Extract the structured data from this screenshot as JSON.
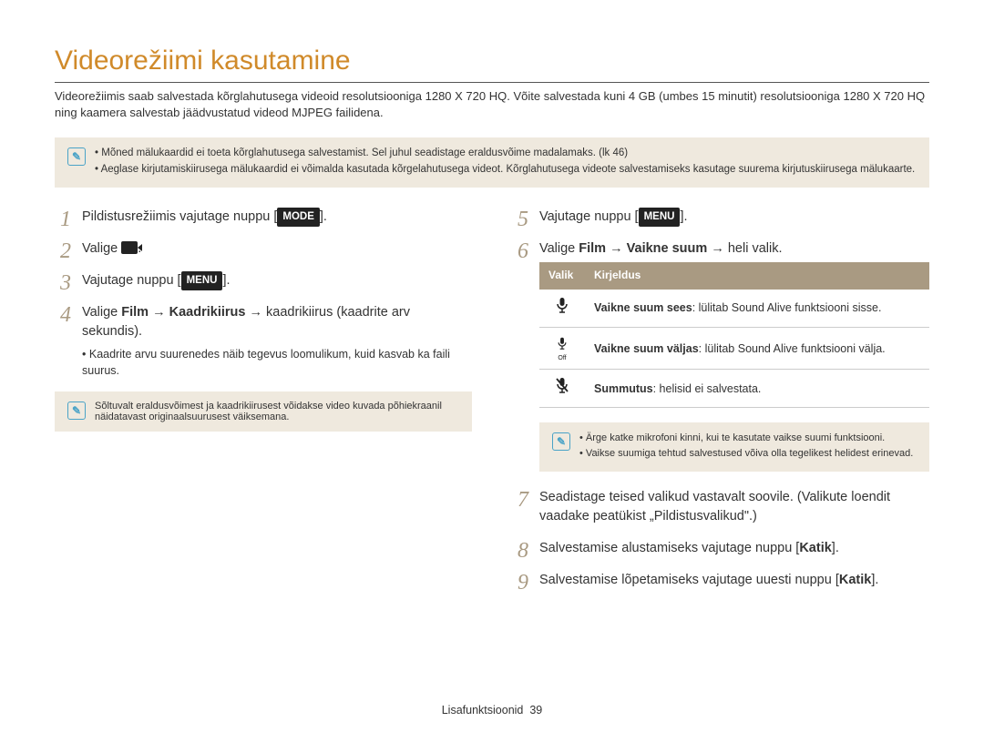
{
  "title": "Videorežiimi kasutamine",
  "intro": "Videorežiimis saab salvestada kõrglahutusega videoid resolutsiooniga 1280 X 720 HQ. Võite salvestada kuni 4 GB (umbes 15 minutit) resolutsiooniga 1280 X 720 HQ ning kaamera salvestab jäädvustatud videod MJPEG failidena.",
  "top_notes": [
    "Mõned mälukaardid ei toeta kõrglahutusega salvestamist. Sel juhul seadistage eraldusvõime madalamaks. (lk 46)",
    "Aeglase kirjutamiskiirusega mälukaardid ei võimalda kasutada kõrgelahutusega videot. Kõrglahutusega videote salvestamiseks kasutage suurema kirjutuskiirusega mälukaarte."
  ],
  "left_steps": {
    "s1_pre": "Pildistusrežiimis vajutage nuppu [",
    "s1_btn": "MODE",
    "s1_post": "].",
    "s2_pre": "Valige ",
    "s2_post": ".",
    "s3_pre": "Vajutage nuppu [",
    "s3_btn": "MENU",
    "s3_post": "].",
    "s4_pre": "Valige ",
    "s4_b1": "Film",
    "s4_arrow1": " → ",
    "s4_b2": "Kaadrikiirus",
    "s4_arrow2": " → ",
    "s4_rest": "kaadrikiirus (kaadrite arv sekundis).",
    "s4_bullet": "Kaadrite arvu suurenedes näib tegevus loomulikum, kuid kasvab ka faili suurus."
  },
  "left_note": "Sõltuvalt eraldusvõimest ja kaadrikiirusest võidakse video kuvada põhiekraanil näidatavast originaalsuurusest väiksemana.",
  "right_steps": {
    "s5_pre": "Vajutage nuppu [",
    "s5_btn": "MENU",
    "s5_post": "].",
    "s6_pre": "Valige ",
    "s6_b1": "Film",
    "s6_arrow1": " → ",
    "s6_b2": "Vaikne suum",
    "s6_arrow2": " → ",
    "s6_rest": "heli valik.",
    "s7": "Seadistage teised valikud vastavalt soovile. (Valikute loendit vaadake peatükist „Pildistusvalikud\".)",
    "s8_pre": "Salvestamise alustamiseks vajutage nuppu [",
    "s8_b": "Katik",
    "s8_post": "].",
    "s9_pre": "Salvestamise lõpetamiseks vajutage uuesti nuppu [",
    "s9_b": "Katik",
    "s9_post": "]."
  },
  "table": {
    "h1": "Valik",
    "h2": "Kirjeldus",
    "r1_b": "Vaikne suum sees",
    "r1_t": ": lülitab Sound Alive funktsiooni sisse.",
    "r2_b": "Vaikne suum väljas",
    "r2_t": ": lülitab Sound Alive funktsiooni välja.",
    "r3_b": "Summutus",
    "r3_t": ": helisid ei salvestata."
  },
  "right_notes": [
    "Ärge katke mikrofoni kinni, kui te kasutate vaikse suumi funktsiooni.",
    "Vaikse suumiga tehtud salvestused võiva olla tegelikest helidest erinevad."
  ],
  "footer_label": "Lisafunktsioonid",
  "footer_page": "39"
}
